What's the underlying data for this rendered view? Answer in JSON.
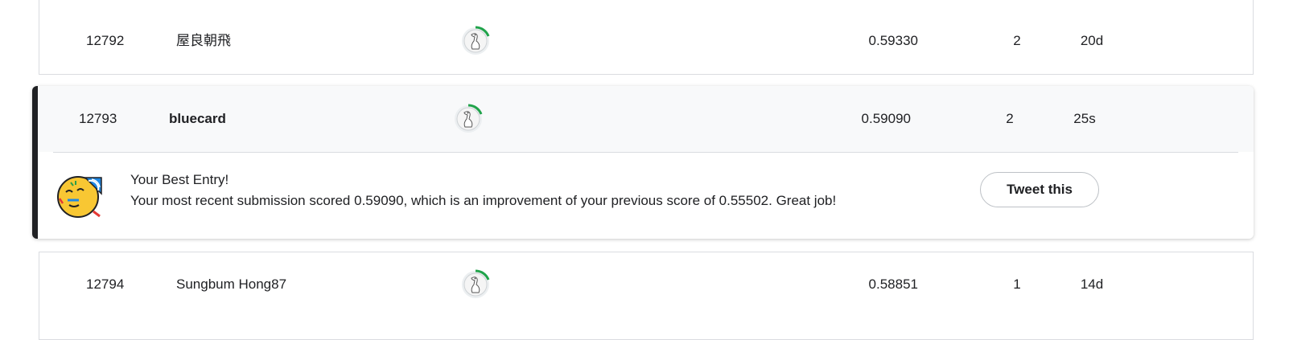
{
  "rows": [
    {
      "rank": "12792",
      "name": "屋良朝飛",
      "score": "0.59330",
      "entries": "2",
      "last": "20d"
    },
    {
      "rank": "12793",
      "name": "bluecard",
      "score": "0.59090",
      "entries": "2",
      "last": "25s"
    },
    {
      "rank": "12794",
      "name": "Sungbum Hong87",
      "score": "0.58851",
      "entries": "1",
      "last": "14d"
    }
  ],
  "best_entry": {
    "title": "Your Best Entry!",
    "message": "Your most recent submission scored 0.59090, which is an improvement of your previous score of 0.55502. Great job!",
    "tweet_label": "Tweet this"
  },
  "colors": {
    "progress_arc": "#20a34a",
    "highlight_bar": "#202124"
  },
  "icons": {
    "avatar": "goose-avatar-icon",
    "celebration": "party-face-icon"
  }
}
